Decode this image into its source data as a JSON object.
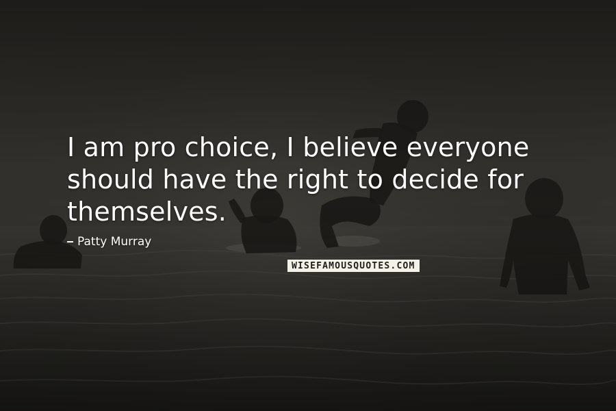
{
  "quote": {
    "text": "I am pro choice, I believe everyone should have the right to decide for themselves.",
    "author": "Patty Murray"
  },
  "watermark": {
    "text": "WISEFAMOUSQUOTES.COM"
  },
  "photo": {
    "subject": "silhouetted children playing in the sea at dusk"
  },
  "colors": {
    "text": "#ffffff",
    "background": "#2b2a27",
    "watermark_bg": "#f4f1e6",
    "watermark_text": "#1d1d1d"
  }
}
